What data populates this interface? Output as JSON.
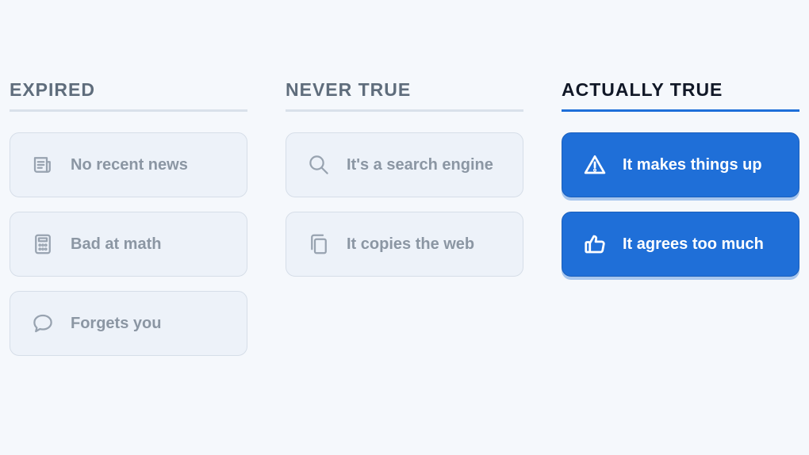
{
  "columns": [
    {
      "title": "EXPIRED",
      "active": false,
      "items": [
        {
          "label": "No recent news",
          "icon": "newspaper-icon"
        },
        {
          "label": "Bad at math",
          "icon": "calculator-icon"
        },
        {
          "label": "Forgets you",
          "icon": "speech-bubble-icon"
        }
      ]
    },
    {
      "title": "NEVER TRUE",
      "active": false,
      "items": [
        {
          "label": "It's a search engine",
          "icon": "search-icon"
        },
        {
          "label": "It copies the web",
          "icon": "copy-icon"
        }
      ]
    },
    {
      "title": "ACTUALLY TRUE",
      "active": true,
      "items": [
        {
          "label": "It makes things up",
          "icon": "warning-icon"
        },
        {
          "label": "It agrees too much",
          "icon": "thumbs-up-icon"
        }
      ]
    }
  ],
  "colors": {
    "accent": "#1e6fd9",
    "muted_text": "#8b96a3",
    "background": "#f5f8fc"
  }
}
